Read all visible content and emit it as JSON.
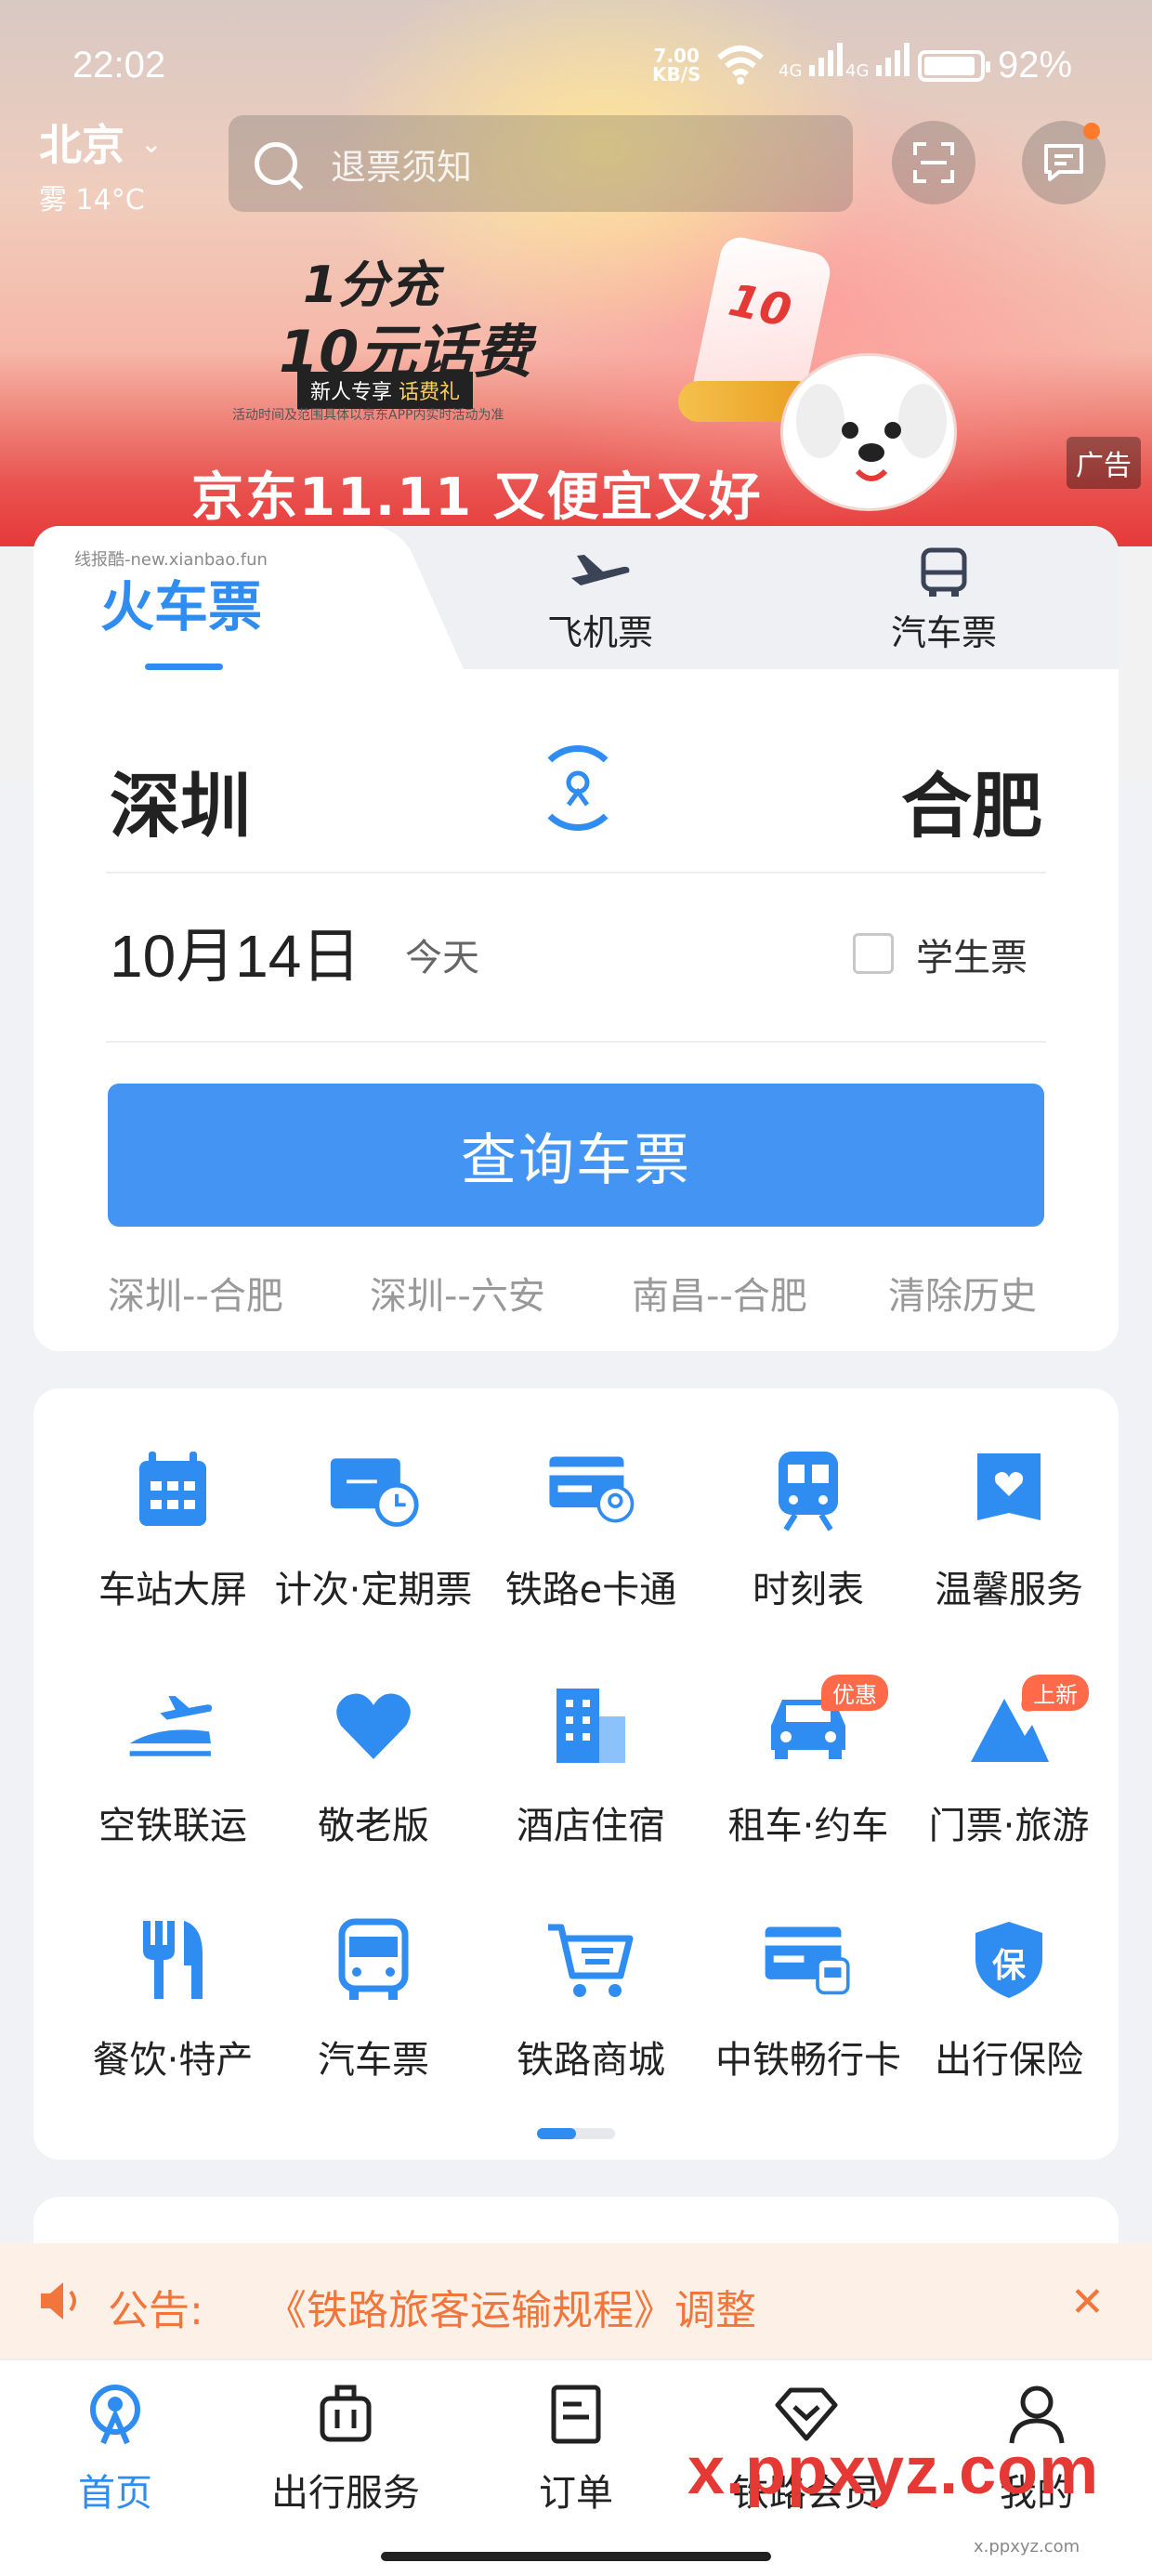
{
  "status_bar": {
    "time": "22:02",
    "net_speed": "7.00",
    "net_speed_unit": "KB/S",
    "signal_1": "4G",
    "signal_2": "4G",
    "battery": "92%"
  },
  "header": {
    "city": "北京",
    "weather": "雾 14°C",
    "search_placeholder": "退票须知",
    "scan_icon": "scan-icon",
    "message_icon": "message-icon"
  },
  "banner": {
    "line1": "1分充",
    "line2": "10元话费",
    "tag_left": "新人专享",
    "tag_right": "话费礼",
    "small_print": "活动时间及范围具体以京东APP内实时活动为准",
    "slogan": "京东11.11 又便宜又好",
    "ad_label": "广告",
    "card_text": "10"
  },
  "ticket_tabs": [
    {
      "label": "火车票",
      "icon": "train-icon",
      "active": true
    },
    {
      "label": "飞机票",
      "icon": "plane-icon",
      "active": false
    },
    {
      "label": "汽车票",
      "icon": "bus-icon",
      "active": false
    }
  ],
  "watermark_top": "线报酷-new.xianbao.fun",
  "booking": {
    "from": "深圳",
    "to": "合肥",
    "date": "10月14日",
    "day": "今天",
    "student_ticket_label": "学生票",
    "student_ticket_checked": false,
    "search_button": "查询车票",
    "history": [
      "深圳--合肥",
      "深圳--六安",
      "南昌--合肥"
    ],
    "clear_history": "清除历史"
  },
  "services": [
    {
      "label": "车站大屏",
      "icon": "calendar-board-icon"
    },
    {
      "label": "计次·定期票",
      "icon": "ticket-clock-icon"
    },
    {
      "label": "铁路e卡通",
      "icon": "rail-card-icon"
    },
    {
      "label": "时刻表",
      "icon": "train-front-icon"
    },
    {
      "label": "温馨服务",
      "icon": "heart-bag-icon"
    },
    {
      "label": "空铁联运",
      "icon": "plane-train-icon"
    },
    {
      "label": "敬老版",
      "icon": "heart-icon"
    },
    {
      "label": "酒店住宿",
      "icon": "hotel-icon"
    },
    {
      "label": "租车·约车",
      "icon": "car-icon",
      "badge": "优惠"
    },
    {
      "label": "门票·旅游",
      "icon": "mountain-icon",
      "badge": "上新"
    },
    {
      "label": "餐饮·特产",
      "icon": "fork-knife-icon"
    },
    {
      "label": "汽车票",
      "icon": "bus-icon"
    },
    {
      "label": "铁路商城",
      "icon": "cart-icon"
    },
    {
      "label": "中铁畅行卡",
      "icon": "rail-pass-card-icon"
    },
    {
      "label": "出行保险",
      "icon": "shield-insurance-icon",
      "glyph": "保"
    }
  ],
  "notice": {
    "label": "公告:",
    "text": "《铁路旅客运输规程》调整"
  },
  "bottom_nav": [
    {
      "label": "首页",
      "icon": "home-rail-icon",
      "active": true
    },
    {
      "label": "出行服务",
      "icon": "luggage-icon",
      "active": false
    },
    {
      "label": "订单",
      "icon": "order-icon",
      "active": false
    },
    {
      "label": "铁路会员",
      "icon": "diamond-icon",
      "active": false
    },
    {
      "label": "我的",
      "icon": "profile-icon",
      "active": false
    }
  ],
  "watermark_bottom": "x.ppxyz.com",
  "watermark_bottom_small": "x.ppxyz.com",
  "colors": {
    "accent": "#2f8cf0",
    "button": "#4495f3",
    "notice": "#f2763b",
    "badge": "#ff6b4a"
  }
}
